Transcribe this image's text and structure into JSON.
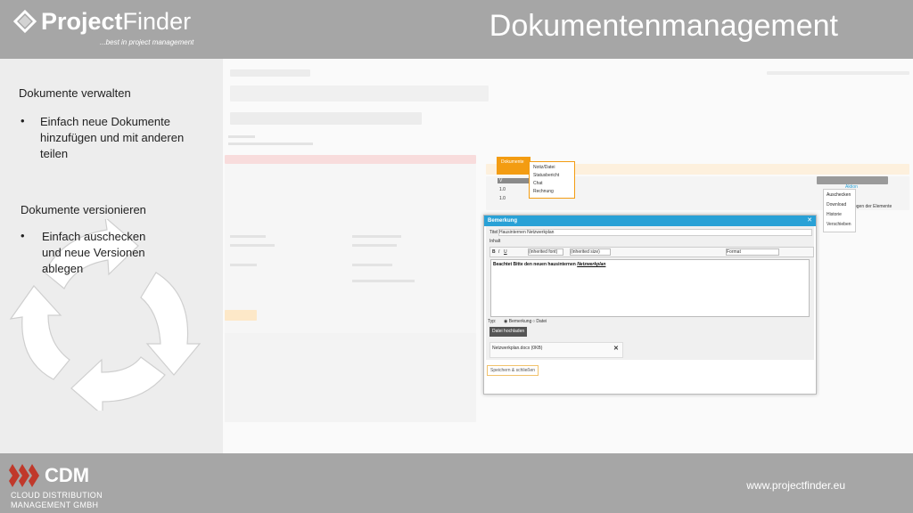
{
  "header": {
    "brand_bold": "Project",
    "brand_light": "Finder",
    "tagline": "...best in project management",
    "title": "Dokumentenmanagement"
  },
  "left": {
    "section1_title": "Dokumente verwalten",
    "section1_bullet": "Einfach neue Dokumente hinzufügen und mit anderen teilen",
    "section2_title": "Dokumente versionieren",
    "section2_bullet": "Einfach auschecken und neue Versionen ablegen",
    "bullet_char": "•"
  },
  "screenshot": {
    "orange_tab_label": "Dokumente",
    "row_v": "V",
    "row_10a": "1.0",
    "row_10b": "1.0",
    "ctx_items": [
      "Notiz/Datei",
      "Statusbericht",
      "Chat",
      "Rechnung"
    ],
    "ctx2_items": [
      "Auschecken",
      "Download",
      "Historie",
      "Verschieben"
    ],
    "ctx2_header": "Aktion",
    "side_text": "ogen der Elemente",
    "dialog": {
      "title": "Bemerkung",
      "titel_label": "Titel",
      "titel_value": "Hausinternen Netzwerkplan",
      "inhalt_label": "Inhalt",
      "font_placeholder": "(inherited font)",
      "size_placeholder": "(inherited size)",
      "format_label": "Format",
      "content_plain": "Beachtet Bitte den neuen hausinternen ",
      "content_link": "Netzwerkplan",
      "typ_label": "Typ:",
      "radio1": "Bemerkung",
      "radio2": "Datei",
      "upload_button": "Datei hochladen",
      "file_name": "Netzwerkplan.docx (0KB)",
      "save_button": "Speichern & schließen"
    }
  },
  "footer": {
    "company": "CDM",
    "company_sub1": "CLOUD DISTRIBUTION",
    "company_sub2": "MANAGEMENT GMBH",
    "url": "www.projectfinder.eu"
  },
  "colors": {
    "header_bg": "#a6a6a6",
    "accent_orange": "#f39c12",
    "dialog_blue": "#29a1d6",
    "cdm_red": "#c0392b"
  }
}
